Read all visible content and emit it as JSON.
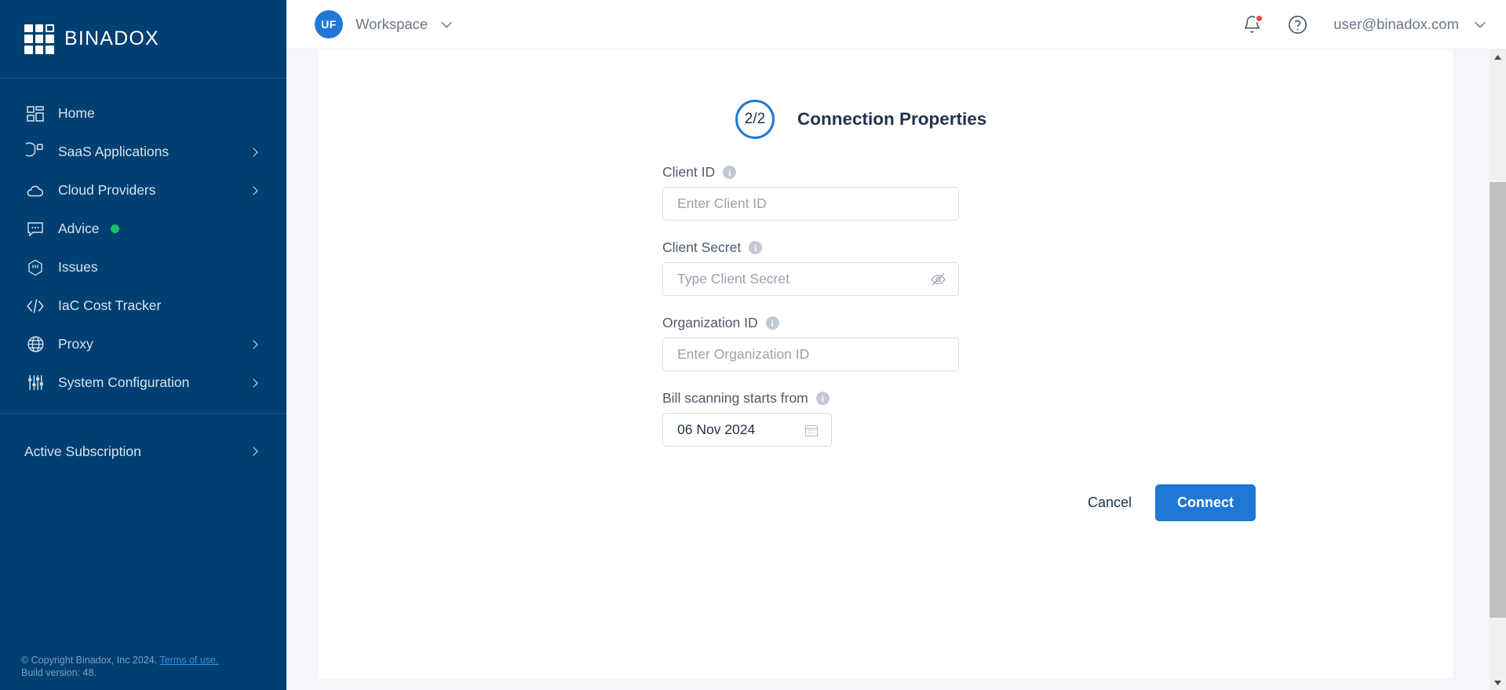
{
  "brand": {
    "name": "BINADOX",
    "logo_icon": "binadox-grid-logo"
  },
  "sidebar": {
    "items": [
      {
        "label": "Home",
        "icon": "dashboard-grid-icon",
        "chevron": false,
        "dot": false
      },
      {
        "label": "SaaS Applications",
        "icon": "pie-chart-icon",
        "chevron": true,
        "dot": false
      },
      {
        "label": "Cloud Providers",
        "icon": "cloud-icon",
        "chevron": true,
        "dot": false
      },
      {
        "label": "Advice",
        "icon": "chat-bubble-icon",
        "chevron": false,
        "dot": true
      },
      {
        "label": "Issues",
        "icon": "hexagon-alert-icon",
        "chevron": false,
        "dot": false
      },
      {
        "label": "IaC Cost Tracker",
        "icon": "code-brackets-icon",
        "chevron": false,
        "dot": false
      },
      {
        "label": "Proxy",
        "icon": "globe-icon",
        "chevron": true,
        "dot": false
      },
      {
        "label": "System Configuration",
        "icon": "sliders-icon",
        "chevron": true,
        "dot": false
      }
    ],
    "subscription": {
      "label": "Active Subscription",
      "chevron": true
    },
    "footer": {
      "copyright": "© Copyright Binadox, Inc 2024.",
      "terms_link": "Terms of use.",
      "build": "Build version: 48."
    },
    "colors": {
      "background": "#003F72",
      "text": "#d7e3ee",
      "dot": "#13c56b",
      "link": "#3e8fe0"
    }
  },
  "topbar": {
    "workspace": {
      "initials": "UF",
      "name": "Workspace",
      "chevron_icon": "chevron-down-icon"
    },
    "notifications_icon": "bell-icon",
    "has_notification": true,
    "help_icon": "question-circle-icon",
    "user": {
      "email": "user@binadox.com",
      "chevron_icon": "chevron-down-icon"
    },
    "colors": {
      "avatar": "#2078d4",
      "badge": "#f8463c",
      "text": "#6b7683"
    }
  },
  "main": {
    "step": {
      "counter": "2/2",
      "title": "Connection Properties"
    },
    "fields": [
      {
        "label": "Client ID",
        "info_icon": "info-icon",
        "placeholder": "Enter Client ID",
        "value": "",
        "trailing_icon": null,
        "narrow": false
      },
      {
        "label": "Client Secret",
        "info_icon": "info-icon",
        "placeholder": "Type Client Secret",
        "value": "",
        "trailing_icon": "eye-off-icon",
        "narrow": false
      },
      {
        "label": "Organization ID",
        "info_icon": "info-icon",
        "placeholder": "Enter Organization ID",
        "value": "",
        "trailing_icon": null,
        "narrow": false
      },
      {
        "label": "Bill scanning starts from",
        "info_icon": "info-icon",
        "placeholder": "",
        "value": "06 Nov 2024",
        "trailing_icon": "calendar-icon",
        "narrow": true
      }
    ],
    "buttons": {
      "cancel": "Cancel",
      "connect": "Connect"
    },
    "colors": {
      "primary": "#2078d4",
      "heading": "#22334d",
      "label": "#4d5a69",
      "placeholder": "#98a2ae"
    }
  },
  "scrollbar": {
    "up_icon": "triangle-up-icon",
    "down_icon": "triangle-down-icon"
  }
}
